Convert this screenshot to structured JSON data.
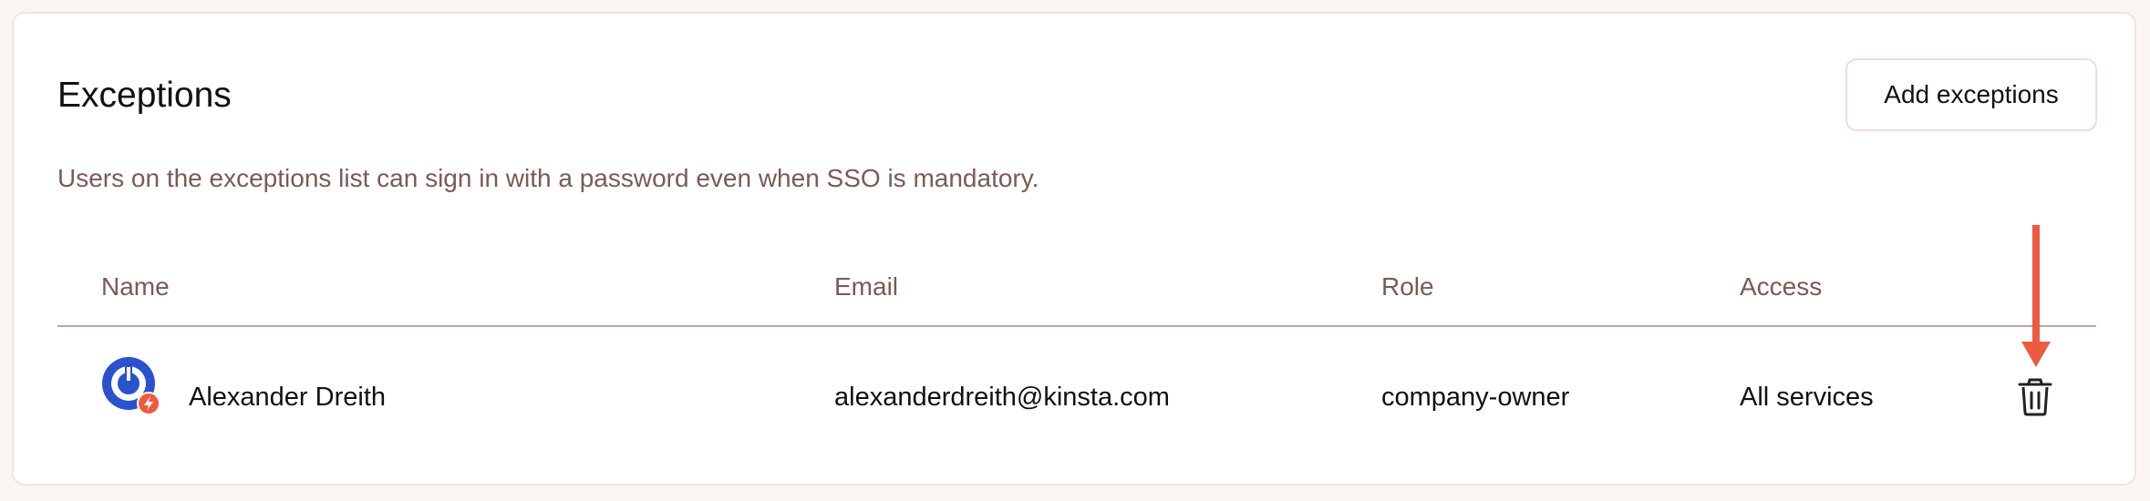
{
  "section": {
    "title": "Exceptions",
    "add_button_label": "Add exceptions",
    "description": "Users on the exceptions list can sign in with a password even when SSO is mandatory."
  },
  "table": {
    "columns": [
      "Name",
      "Email",
      "Role",
      "Access"
    ],
    "rows": [
      {
        "name": "Alexander Dreith",
        "email": "alexanderdreith@kinsta.com",
        "role": "company-owner",
        "access": "All services",
        "avatar_icon": "power-icon",
        "avatar_badge_icon": "lightning-bolt-icon",
        "action_icon": "trash-icon"
      }
    ]
  },
  "annotation": {
    "arrow_icon": "down-arrow-icon",
    "arrow_color": "#ea5b40"
  },
  "colors": {
    "avatar_blue": "#2a52cf",
    "badge_red": "#f05a3c",
    "muted_text": "#7a5a56"
  }
}
